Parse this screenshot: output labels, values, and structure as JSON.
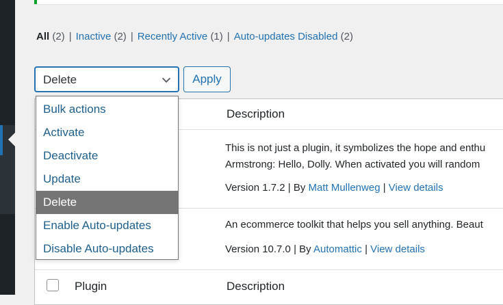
{
  "filters": [
    {
      "label": "All",
      "count": "(2)",
      "current": true
    },
    {
      "label": "Inactive",
      "count": "(2)"
    },
    {
      "label": "Recently Active",
      "count": "(1)"
    },
    {
      "label": "Auto-updates Disabled",
      "count": "(2)"
    }
  ],
  "filter_separator": "|",
  "bulk": {
    "selected": "Delete",
    "apply_label": "Apply",
    "options": [
      "Bulk actions",
      "Activate",
      "Deactivate",
      "Update",
      "Delete",
      "Enable Auto-updates",
      "Disable Auto-updates"
    ],
    "selected_index": 4
  },
  "table": {
    "header_description": "Description",
    "footer_plugin": "Plugin",
    "footer_description": "Description",
    "rows": [
      {
        "desc_line1": "This is not just a plugin, it symbolizes the hope and enthu",
        "desc_line2": "Armstrong: Hello, Dolly. When activated you will random",
        "version": "Version 1.7.2",
        "by": "By",
        "author": "Matt Mullenweg",
        "details": "View details"
      },
      {
        "desc_line1": "An ecommerce toolkit that helps you sell anything. Beaut",
        "version": "Version 10.7.0",
        "by": "By",
        "author": "Automattic",
        "details": "View details"
      }
    ]
  },
  "colors": {
    "link": "#2271b1",
    "selected_option_bg": "#757575",
    "notice_border": "#00a32a",
    "sidebar": "#1d2327"
  }
}
